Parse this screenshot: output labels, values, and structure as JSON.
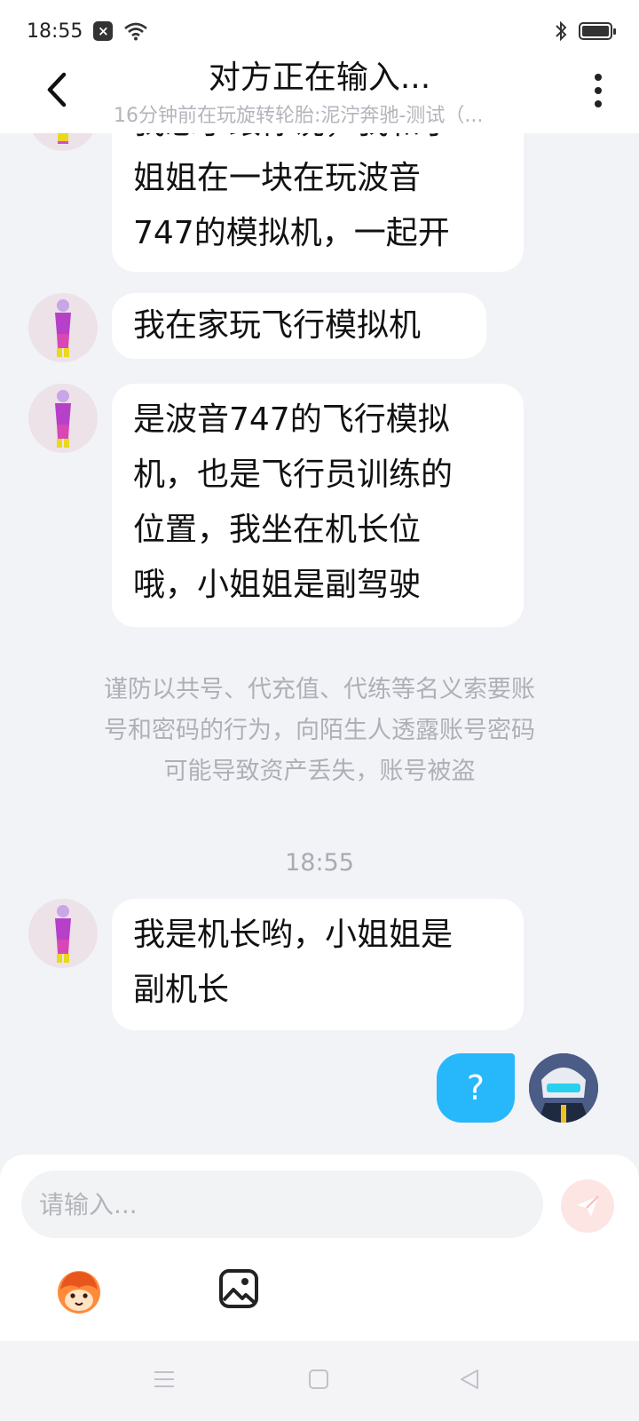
{
  "status_bar": {
    "time": "18:55"
  },
  "header": {
    "title": "对方正在输入...",
    "subtitle": "16分钟前在玩旋转轮胎:泥泞奔驰-测试（..."
  },
  "messages": [
    {
      "line0": "我想了跟你说，我和小",
      "line1": "姐姐在一块在玩波音",
      "line2": "747的模拟机，一起开"
    },
    {
      "text": "我在家玩飞行模拟机"
    },
    {
      "line0": "是波音747的飞行模拟",
      "line1": "机，也是飞行员训练的",
      "line2": "位置，我坐在机长位",
      "line3": "哦，小姐姐是副驾驶"
    }
  ],
  "notice": {
    "line0": "谨防以共号、代充值、代练等名义索要账",
    "line1": "号和密码的行为，向陌生人透露账号密码",
    "line2": "可能导致资产丢失，账号被盗"
  },
  "timestamp": "18:55",
  "last_message": {
    "line0": "我是机长哟，小姐姐是",
    "line1": "副机长"
  },
  "my_message": "?",
  "input": {
    "placeholder": "请输入..."
  },
  "colors": {
    "my_bubble": "#27b7fb",
    "send_button": "#fde5e4",
    "background": "#f2f3f7"
  },
  "icons": [
    "back-arrow-icon",
    "more-vertical-icon",
    "send-icon",
    "emoji-icon",
    "image-icon",
    "menu-icon",
    "home-icon",
    "back-triangle-icon"
  ]
}
